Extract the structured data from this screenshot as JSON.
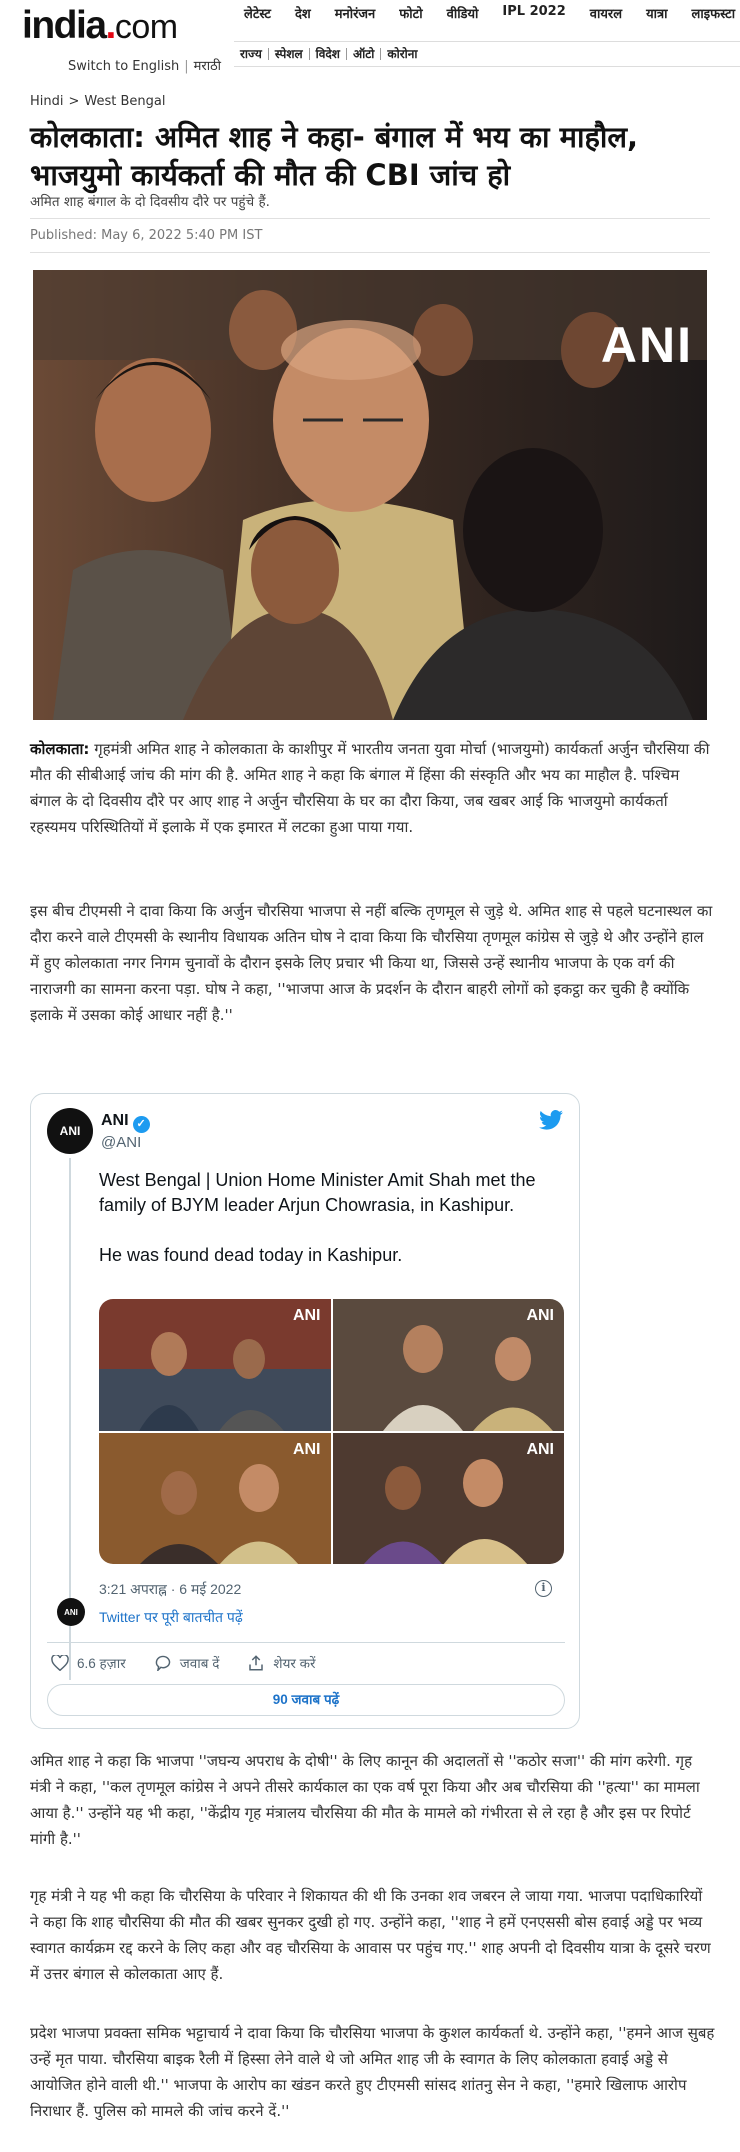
{
  "header": {
    "logo_main": "india",
    "logo_dot": ".",
    "logo_com": "com",
    "switch_label": "Switch to English",
    "lang_label": "मराठी",
    "nav_top": [
      "लेटेस्ट",
      "देश",
      "मनोरंजन",
      "फोटो",
      "वीडियो",
      "IPL 2022",
      "वायरल",
      "यात्रा",
      "लाइफस्टा"
    ],
    "nav_sub": [
      "राज्य",
      "स्पेशल",
      "विदेश",
      "ऑटो",
      "कोरोना"
    ]
  },
  "breadcrumb": {
    "home": "Hindi",
    "separator": ">",
    "section": "West Bengal"
  },
  "article": {
    "headline": "कोलकाता: अमित शाह ने कहा- बंगाल में भय का माहौल, भाजयुमो कार्यकर्ता की मौत की CBI जांच हो",
    "summary": "अमित शाह बंगाल के दो दिवसीय दौरे पर पहुंचे हैं.",
    "published": "Published: May 6, 2022 5:40 PM IST",
    "image_watermark": "ANI",
    "para1_dateline": "कोलकाता:",
    "para1": " गृहमंत्री अमित शाह ने कोलकाता के काशीपुर में भारतीय जनता युवा मोर्चा (भाजयुमो) कार्यकर्ता अर्जुन चौरसिया की मौत की सीबीआई जांच की मांग की है. अमित शाह ने कहा कि बंगाल में हिंसा की संस्कृति और भय का माहौल है. पश्चिम बंगाल के दो दिवसीय दौरे पर आए शाह ने अर्जुन चौरसिया के घर का दौरा किया, जब खबर आई कि भाजयुमो कार्यकर्ता रहस्यमय परिस्थितियों में इलाके में एक इमारत में लटका हुआ पाया गया.",
    "para2": "इस बीच टीएमसी ने दावा किया कि अर्जुन चौरसिया भाजपा से नहीं बल्कि तृणमूल से जुड़े थे. अमित शाह से पहले घटनास्थल का दौरा करने वाले टीएमसी के स्थानीय विधायक अतिन घोष ने दावा किया कि चौरसिया तृणमूल कांग्रेस से जुड़े थे और उन्होंने हाल में हुए कोलकाता नगर निगम चुनावों के दौरान इसके लिए प्रचार भी किया था, जिससे उन्हें स्थानीय भाजपा के एक वर्ग की नाराजगी का सामना करना पड़ा. घोष ने कहा, ''भाजपा आज के प्रदर्शन के दौरान बाहरी लोगों को इकट्ठा कर चुकी है क्योंकि इलाके में उसका कोई आधार नहीं है.''",
    "para3": "अमित शाह ने कहा कि भाजपा ''जघन्य अपराध के दोषी'' के लिए कानून की अदालतों से ''कठोर सजा'' की मांग करेगी. गृह मंत्री ने कहा, ''कल तृणमूल कांग्रेस ने अपने तीसरे कार्यकाल का एक वर्ष पूरा किया और अब चौरसिया की ''हत्या'' का मामला आया है.'' उन्होंने यह भी कहा, ''केंद्रीय गृह मंत्रालय चौरसिया की मौत के मामले को गंभीरता से ले रहा है और इस पर रिपोर्ट मांगी है.''",
    "para4": "गृह मंत्री ने यह भी कहा कि चौरसिया के परिवार ने शिकायत की थी कि उनका शव जबरन ले जाया गया. भाजपा पदाधिकारियों ने कहा कि शाह चौरसिया की मौत की खबर सुनकर दुखी हो गए. उन्होंने कहा, ''शाह ने हमें एनएससी बोस हवाई अड्डे पर भव्य स्वागत कार्यक्रम रद्द करने के लिए कहा और वह चौरसिया के आवास पर पहुंच गए.'' शाह अपनी दो दिवसीय यात्रा के दूसरे चरण में उत्तर बंगाल से कोलकाता आए हैं.",
    "para5": "प्रदेश भाजपा प्रवक्ता समिक भट्टाचार्य ने दावा किया कि चौरसिया भाजपा के कुशल कार्यकर्ता थे. उन्होंने कहा, ''हमने आज सुबह उन्हें मृत पाया. चौरसिया बाइक रैली में हिस्सा लेने वाले थे जो अमित शाह जी के स्वागत के लिए कोलकाता हवाई अड्डे से आयोजित होने वाली थी.'' भाजपा के आरोप का खंडन करते हुए टीएमसी सांसद शांतनु सेन ने कहा, ''हमारे खिलाफ आरोप निराधार हैं. पुलिस को मामले की जांच करने दें.''"
  },
  "tweet": {
    "author_name": "ANI",
    "author_handle": "@ANI",
    "avatar_text": "ANI",
    "verified_mark": "✓",
    "text": "West Bengal | Union Home Minister Amit Shah met the family of BJYM leader Arjun Chowrasia, in Kashipur.\n\nHe was found dead today in Kashipur.",
    "photo_watermark": "ANI",
    "timestamp": "3:21 अपराह्न · 6 मई 2022",
    "info_glyph": "i",
    "conversation_link": "Twitter पर पूरी बातचीत पढ़ें",
    "likes": "6.6 हज़ार",
    "reply_label": "जवाब दें",
    "share_label": "शेयर करें",
    "read_replies": "90 जवाब पढ़ें"
  }
}
